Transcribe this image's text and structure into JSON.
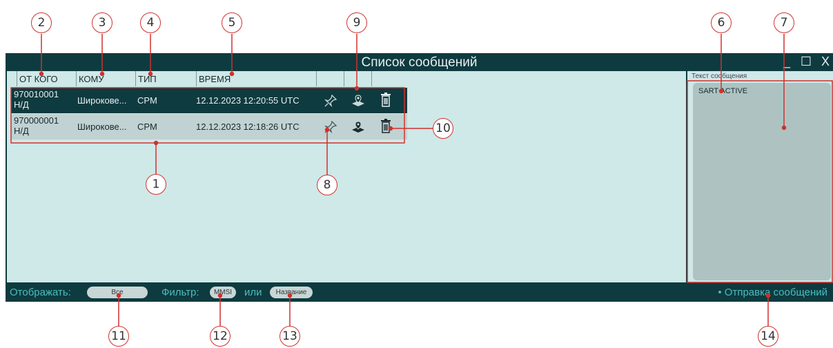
{
  "window": {
    "title": "Список сообщений",
    "controls": {
      "minimize": "_",
      "maximize": "☐",
      "close": "X"
    }
  },
  "columns": [
    "ОТ КОГО",
    "КОМУ",
    "ТИП",
    "ВРЕМЯ"
  ],
  "messages": [
    {
      "from_line1": "970010001",
      "from_line2": "Н/Д",
      "to": "Широкове...",
      "type": "CPM",
      "time": "12.12.2023 12:20:55 UTC",
      "selected": true
    },
    {
      "from_line1": "970000001",
      "from_line2": "Н/Д",
      "to": "Широкове...",
      "type": "CPM",
      "time": "12.12.2023 12:18:26 UTC",
      "selected": false
    }
  ],
  "side_panel": {
    "label": "Текст сообщения",
    "text": "SART ACTIVE"
  },
  "footer": {
    "display_label": "Отображать:",
    "display_value": "Все",
    "filter_label": "Фильтр:",
    "filter_mmsi": "MMSI",
    "or_label": "или",
    "filter_name": "Название",
    "send_link": "• Отправка сообщений"
  },
  "callouts": [
    "1",
    "2",
    "3",
    "4",
    "5",
    "6",
    "7",
    "8",
    "9",
    "10",
    "11",
    "12",
    "13",
    "14"
  ],
  "colors": {
    "dark": "#0e3b3f",
    "light": "#cfe8e8",
    "accent": "#4bbcbf",
    "callout": "#d0312d"
  }
}
